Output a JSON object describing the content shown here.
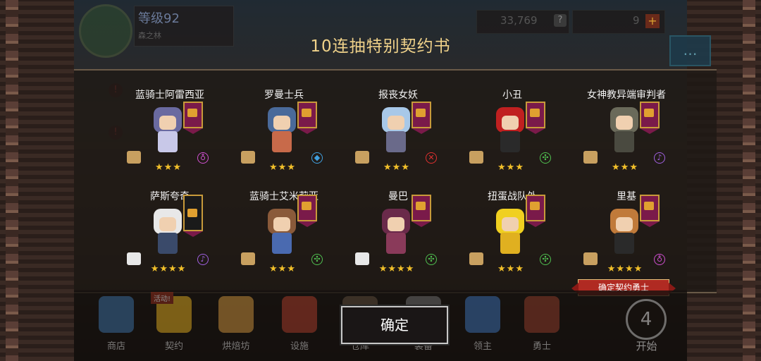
{
  "hud": {
    "level": "等级92",
    "level_sub": "森之林",
    "gold": "33,769",
    "gold_help": "?",
    "gems": "9",
    "gem_plus": "+",
    "chat_icon": "chat-bubble-icon"
  },
  "dialog": {
    "title": "10连抽特别契约书",
    "confirm_button": "确定",
    "confirm_ribbon": "确定契约勇士"
  },
  "characters": [
    {
      "name": "蓝骑士阿雷西亚",
      "stars": "★★★",
      "element": "♁",
      "element_color": "#d050d0",
      "scroll": "gold",
      "hair": "#6a6aa0",
      "body": "#c8c8e8"
    },
    {
      "name": "罗曼士兵",
      "stars": "★★★",
      "element": "◆",
      "element_color": "#40a0e0",
      "scroll": "gold",
      "hair": "#4a6a9a",
      "body": "#c86a4a"
    },
    {
      "name": "报丧女妖",
      "stars": "★★★",
      "element": "✕",
      "element_color": "#e03030",
      "scroll": "gold",
      "hair": "#a8c8e8",
      "body": "#6a6a8a"
    },
    {
      "name": "小丑",
      "stars": "★★★",
      "element": "✣",
      "element_color": "#50c050",
      "scroll": "gold",
      "hair": "#c02020",
      "body": "#2a2a2a"
    },
    {
      "name": "女神教异端审判者",
      "stars": "★★★",
      "element": "♪",
      "element_color": "#a060e0",
      "scroll": "gold",
      "hair": "#6a6a5a",
      "body": "#4a4a40"
    },
    {
      "name": "萨斯夸奇",
      "stars": "★★★★",
      "element": "♪",
      "element_color": "#a060e0",
      "scroll": "white",
      "hair": "#e8e8e8",
      "body": "#3a4a6a"
    },
    {
      "name": "蓝骑士艾米莉亚",
      "stars": "★★★",
      "element": "✣",
      "element_color": "#50c050",
      "scroll": "gold",
      "hair": "#8a5a3a",
      "body": "#4a6ab0"
    },
    {
      "name": "曼巴",
      "stars": "★★★★",
      "element": "✣",
      "element_color": "#50c050",
      "scroll": "white",
      "hair": "#6a2a4a",
      "body": "#8a3a5a"
    },
    {
      "name": "扭蛋战队外",
      "stars": "★★★",
      "element": "✣",
      "element_color": "#50c050",
      "scroll": "gold",
      "hair": "#f0d020",
      "body": "#e0b020"
    },
    {
      "name": "里基",
      "stars": "★★★★",
      "element": "♁",
      "element_color": "#d050d0",
      "scroll": "gold",
      "hair": "#c07a3a",
      "body": "#2a2a2a"
    }
  ],
  "nav": [
    {
      "label": "商店",
      "tag": "",
      "color": "#3a6a9a"
    },
    {
      "label": "契约",
      "tag": "活动!",
      "color": "#d0a020"
    },
    {
      "label": "烘焙坊",
      "tag": "",
      "color": "#c08a3a"
    },
    {
      "label": "设施",
      "tag": "",
      "color": "#a03a2a"
    },
    {
      "label": "仓库",
      "tag": "",
      "color": "#5a4a3a"
    },
    {
      "label": "装备",
      "tag": "",
      "color": "#6a6a6a"
    },
    {
      "label": "领主",
      "tag": "",
      "color": "#3a6aaa"
    },
    {
      "label": "勇士",
      "tag": "",
      "color": "#8a3a2a"
    }
  ],
  "start": {
    "label": "开始",
    "icon_text": "4"
  }
}
